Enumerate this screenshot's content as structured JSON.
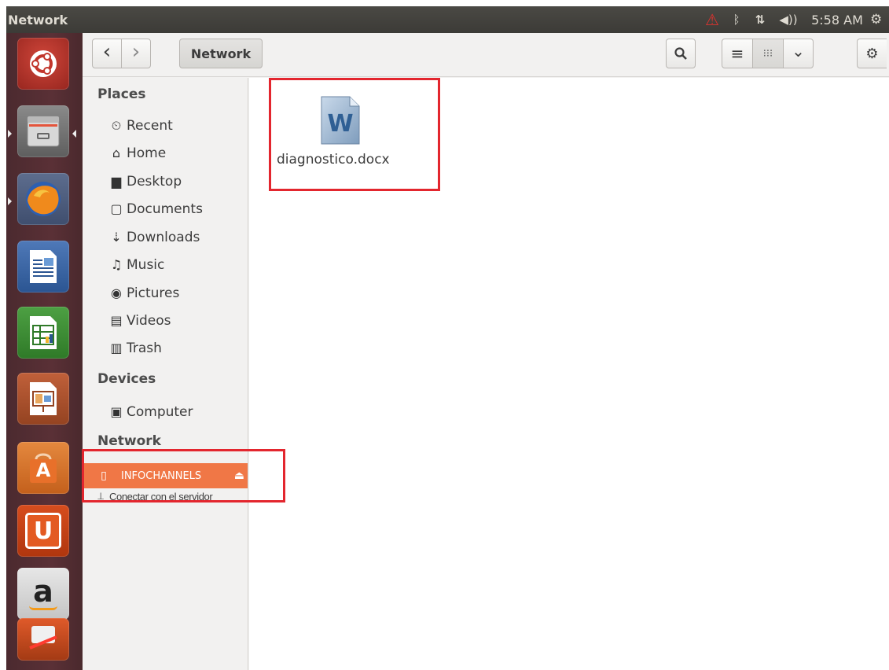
{
  "top_panel": {
    "title": "Network",
    "warning_icon": "warning-triangle-icon",
    "bluetooth_icon": "bluetooth-icon",
    "network_icon": "network-arrows-icon",
    "volume_icon": "volume-icon",
    "clock": "5:58 AM",
    "power_icon": "power-gear-icon"
  },
  "launcher": {
    "items": [
      {
        "name": "ubuntu-dash",
        "icon": "ubuntu-logo-icon"
      },
      {
        "name": "files",
        "icon": "file-cabinet-icon"
      },
      {
        "name": "firefox",
        "icon": "firefox-icon"
      },
      {
        "name": "libreoffice-writer",
        "icon": "writer-icon"
      },
      {
        "name": "libreoffice-calc",
        "icon": "calc-icon"
      },
      {
        "name": "libreoffice-impress",
        "icon": "impress-icon"
      },
      {
        "name": "software-center",
        "icon": "software-center-icon"
      },
      {
        "name": "ubuntu-one",
        "icon": "ubuntu-one-icon"
      },
      {
        "name": "amazon",
        "icon": "amazon-icon"
      },
      {
        "name": "software-updater",
        "icon": "updater-icon"
      }
    ],
    "amazon_letter": "a",
    "software_center_letter": "A",
    "ubuntu_one_letter": "U",
    "writer_letter": "",
    "launcher_amazon_color": "#e7e7e7"
  },
  "toolbar": {
    "back_icon": "‹",
    "forward_icon": "›",
    "path_label": "Network",
    "search_icon": "search-icon",
    "list_icon": "≡",
    "grid_icon": "⁝⁝⁝",
    "view_menu_icon": "⌄",
    "gear_icon": "⚙"
  },
  "sidebar": {
    "places_heading": "Places",
    "places": [
      {
        "label": "Recent",
        "icon": "⏲"
      },
      {
        "label": "Home",
        "icon": "⌂"
      },
      {
        "label": "Desktop",
        "icon": "▆"
      },
      {
        "label": "Documents",
        "icon": "▢"
      },
      {
        "label": "Downloads",
        "icon": "⇣"
      },
      {
        "label": "Music",
        "icon": "♫"
      },
      {
        "label": "Pictures",
        "icon": "◉"
      },
      {
        "label": "Videos",
        "icon": "▤"
      },
      {
        "label": "Trash",
        "icon": "▥"
      }
    ],
    "devices_heading": "Devices",
    "devices": [
      {
        "label": "Computer",
        "icon": "▣"
      }
    ],
    "network_heading": "Network",
    "network_active": "INFOCHANNELS",
    "network_active_icon": "▯",
    "eject_icon": "⏏",
    "connect_label": "Conectar con el servidor",
    "connect_icon": "⍊"
  },
  "content": {
    "file_name": "diagnostico.docx",
    "file_icon_letter": "W"
  },
  "colors": {
    "accent": "#f07746",
    "highlight_red": "#e3262e",
    "panel": "#3c3b37",
    "launcher": "#5a3036"
  }
}
